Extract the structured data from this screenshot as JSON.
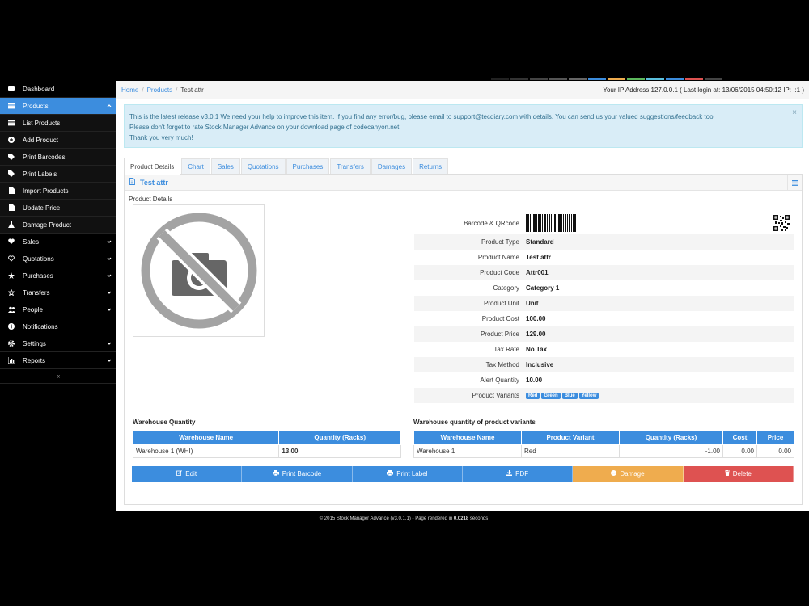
{
  "sidebar": {
    "items": [
      {
        "label": "Dashboard",
        "icon": "dashboard-icon"
      },
      {
        "label": "Products",
        "icon": "list-icon"
      },
      {
        "label": "List Products",
        "icon": "list-icon"
      },
      {
        "label": "Add Product",
        "icon": "plus-circle-icon"
      },
      {
        "label": "Print Barcodes",
        "icon": "tag-icon"
      },
      {
        "label": "Print Labels",
        "icon": "tag-icon"
      },
      {
        "label": "Import Products",
        "icon": "file-icon"
      },
      {
        "label": "Update Price",
        "icon": "file-icon"
      },
      {
        "label": "Damage Product",
        "icon": "flask-icon"
      },
      {
        "label": "Sales",
        "icon": "heart-icon"
      },
      {
        "label": "Quotations",
        "icon": "heart-outline-icon"
      },
      {
        "label": "Purchases",
        "icon": "star-icon"
      },
      {
        "label": "Transfers",
        "icon": "star-outline-icon"
      },
      {
        "label": "People",
        "icon": "users-icon"
      },
      {
        "label": "Notifications",
        "icon": "info-icon"
      },
      {
        "label": "Settings",
        "icon": "cog-icon"
      },
      {
        "label": "Reports",
        "icon": "bar-chart-icon"
      }
    ],
    "collapse_label": "«"
  },
  "breadcrumb": {
    "home": "Home",
    "products": "Products",
    "current": "Test attr"
  },
  "header": {
    "ip_info": "Your IP Address 127.0.0.1 ( Last login at: 13/06/2015 04:50:12 IP: ::1 )"
  },
  "alert": {
    "line1": "This is the latest release v3.0.1 We need your help to improve this item. If you find any error/bug, please email to support@tecdiary.com with details. You can send us your valued suggestions/feedback too.",
    "line2": "Please don't forget to rate Stock Manager Advance on your download page of codecanyon.net",
    "line3": "Thank you very much!",
    "close": "×"
  },
  "tabs": [
    "Product Details",
    "Chart",
    "Sales",
    "Quotations",
    "Purchases",
    "Transfers",
    "Damages",
    "Returns"
  ],
  "box": {
    "title": "Test attr",
    "section": "Product Details"
  },
  "details": {
    "barcode_label": "Barcode & QRcode",
    "rows": [
      {
        "k": "Product Type",
        "v": "Standard"
      },
      {
        "k": "Product Name",
        "v": "Test attr"
      },
      {
        "k": "Product Code",
        "v": "Attr001"
      },
      {
        "k": "Category",
        "v": "Category 1"
      },
      {
        "k": "Product Unit",
        "v": "Unit"
      },
      {
        "k": "Product Cost",
        "v": "100.00"
      },
      {
        "k": "Product Price",
        "v": "129.00"
      },
      {
        "k": "Tax Rate",
        "v": "No Tax"
      },
      {
        "k": "Tax Method",
        "v": "Inclusive"
      },
      {
        "k": "Alert Quantity",
        "v": "10.00"
      }
    ],
    "variants_label": "Product Variants",
    "variants": [
      "Red",
      "Green",
      "Blue",
      "Yellow"
    ]
  },
  "warehouse": {
    "title": "Warehouse Quantity",
    "headers": [
      "Warehouse Name",
      "Quantity (Racks)"
    ],
    "rows": [
      {
        "name": "Warehouse 1 (WHI)",
        "qty": "13.00"
      }
    ]
  },
  "variant_qty": {
    "title": "Warehouse quantity of product variants",
    "headers": [
      "Warehouse Name",
      "Product Variant",
      "Quantity (Racks)",
      "Cost",
      "Price"
    ],
    "rows": [
      {
        "name": "Warehouse 1",
        "variant": "Red",
        "qty": "-1.00",
        "cost": "0.00",
        "price": "0.00"
      }
    ]
  },
  "actions": {
    "edit": "Edit",
    "print_barcode": "Print Barcode",
    "print_label": "Print Label",
    "pdf": "PDF",
    "damage": "Damage",
    "delete": "Delete"
  },
  "footer": {
    "text": "© 2015 Stock Manager Advance (v3.0.1.1) - Page rendered in ",
    "time": "0.0218",
    "suffix": " seconds"
  },
  "colors": {
    "accent": "#3c8dde",
    "orange": "#efac4e",
    "red": "#de5251"
  }
}
